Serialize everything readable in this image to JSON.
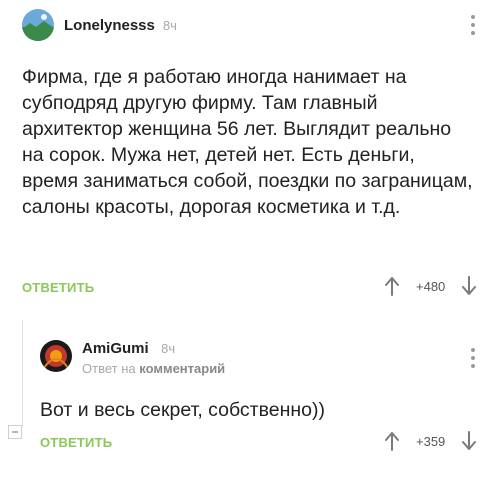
{
  "comment1": {
    "author": "Lonelynesss",
    "time": "8ч",
    "text": "Фирма, где я работаю иногда нанимает на субподряд другую фирму. Там главный архитектор женщина 56 лет. Выглядит реально на сорок. Мужа нет, детей нет. Есть деньги, время заниматься собой, поездки по заграницам, салоны красоты, дорогая косметика и т.д.",
    "reply_label": "ОТВЕТИТЬ",
    "score": "+480"
  },
  "comment2": {
    "author": "AmiGumi",
    "time": "8ч",
    "reply_to_prefix": "Ответ на",
    "reply_to_target": "комментарий",
    "text": "Вот и весь секрет, собственно))",
    "reply_label": "ОТВЕТИТЬ",
    "score": "+359"
  },
  "icons": [
    "avatar-landscape",
    "avatar-abstract",
    "more-vertical-icon",
    "arrow-up-icon",
    "arrow-down-icon",
    "collapse-icon"
  ],
  "colors": {
    "reply": "#8ac858",
    "muted": "#a8a8a8",
    "text": "#222222"
  }
}
